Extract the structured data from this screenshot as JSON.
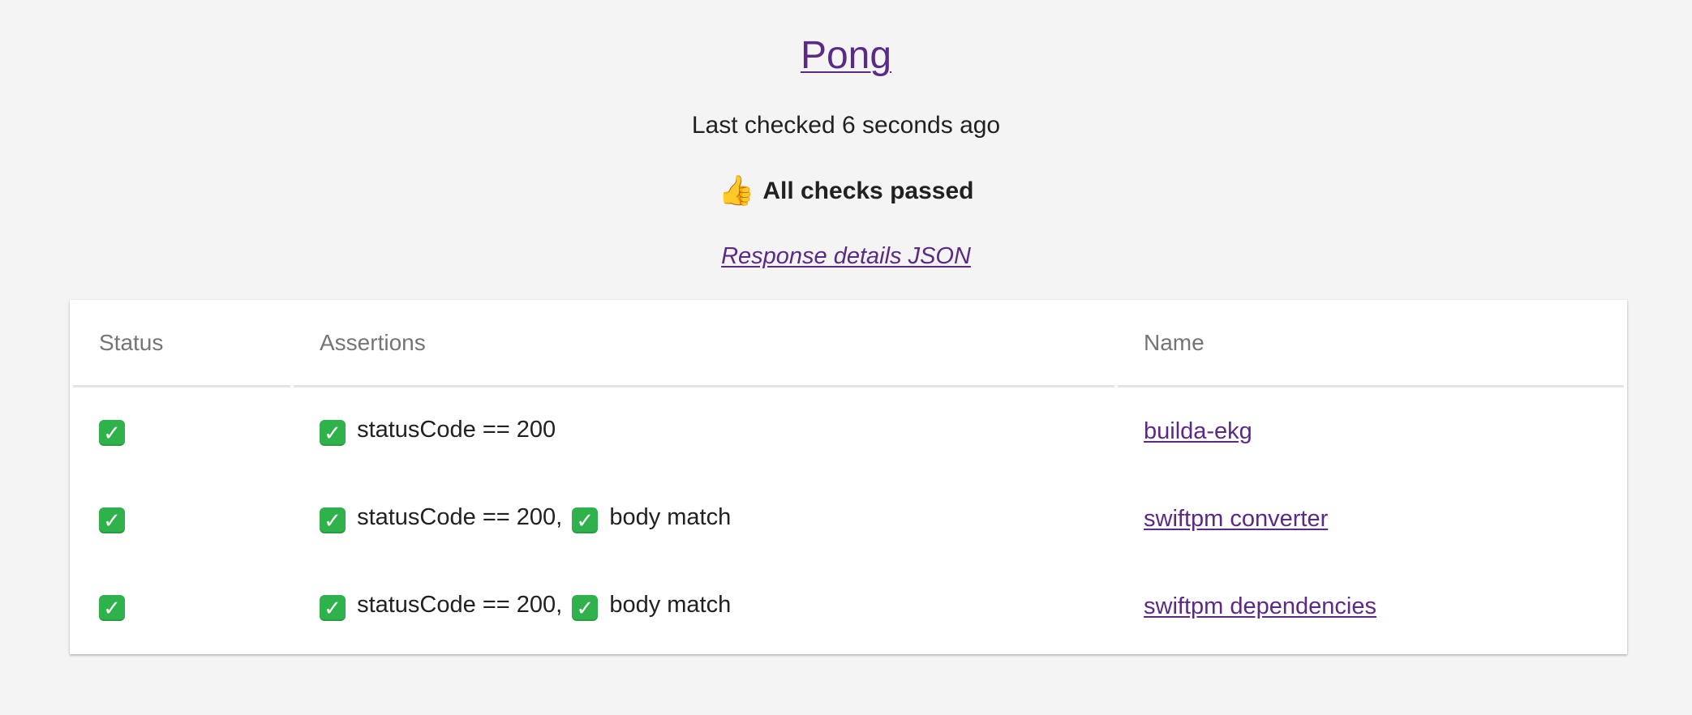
{
  "header": {
    "title": "Pong",
    "last_checked": "Last checked 6 seconds ago",
    "summary_icon": "thumbs-up",
    "summary_emoji": "👍",
    "summary": "All checks passed",
    "details_link": "Response details JSON"
  },
  "table": {
    "columns": {
      "status": "Status",
      "assertions": "Assertions",
      "name": "Name"
    },
    "rows": [
      {
        "status_icon": "check-mark-button",
        "status_glyph": "✓",
        "assertions": [
          {
            "icon": "check-mark-button",
            "glyph": "✓",
            "text": "statusCode == 200"
          }
        ],
        "name": "builda-ekg"
      },
      {
        "status_icon": "check-mark-button",
        "status_glyph": "✓",
        "assertions": [
          {
            "icon": "check-mark-button",
            "glyph": "✓",
            "text": "statusCode == 200,"
          },
          {
            "icon": "check-mark-button",
            "glyph": "✓",
            "text": "body match"
          }
        ],
        "name": "swiftpm converter"
      },
      {
        "status_icon": "check-mark-button",
        "status_glyph": "✓",
        "assertions": [
          {
            "icon": "check-mark-button",
            "glyph": "✓",
            "text": "statusCode == 200,"
          },
          {
            "icon": "check-mark-button",
            "glyph": "✓",
            "text": "body match"
          }
        ],
        "name": "swiftpm dependencies"
      }
    ]
  },
  "colors": {
    "background": "#f4f4f4",
    "link": "#5b2a86",
    "check_green": "#2fb24c",
    "header_text": "#757575"
  }
}
